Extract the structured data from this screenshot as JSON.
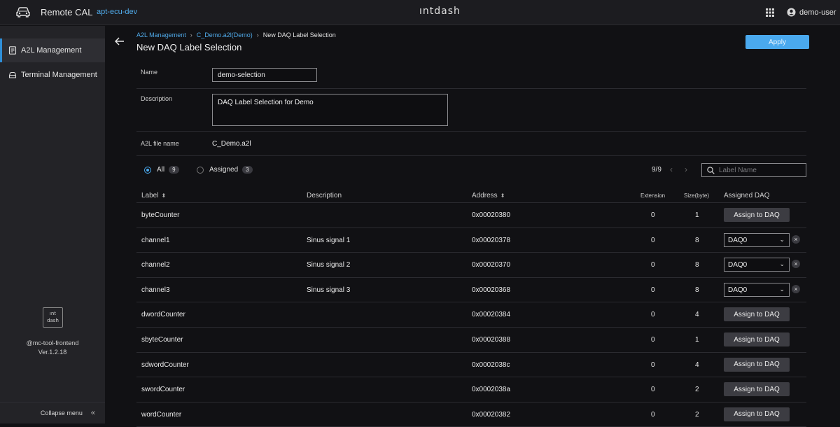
{
  "topbar": {
    "app_title": "Remote CAL",
    "environment": "apt-ecu-dev",
    "brand": "ıntdash",
    "user": "demo-user",
    "icons": [
      "car-icon",
      "apps-grid-icon",
      "user-icon"
    ]
  },
  "sidebar": {
    "items": [
      {
        "label": "A2L Management",
        "icon": "document-icon",
        "active": true
      },
      {
        "label": "Terminal Management",
        "icon": "terminal-icon",
        "active": false
      }
    ],
    "logo_line1": "ıntdash",
    "logo_text_top": "ınt",
    "logo_text_bottom": "dash",
    "package": "@mc-tool-frontend",
    "version": "Ver.1.2.18",
    "collapse_label": "Collapse menu"
  },
  "header": {
    "breadcrumb": [
      "A2L Management",
      "C_Demo.a2l(Demo)",
      "New DAQ Label Selection"
    ],
    "title": "New DAQ Label Selection",
    "apply_label": "Apply"
  },
  "form": {
    "name_label": "Name",
    "name_value": "demo-selection",
    "description_label": "Description",
    "description_value": "DAQ Label Selection for Demo",
    "a2l_label": "A2L file name",
    "a2l_value": "C_Demo.a2l"
  },
  "filter": {
    "all_label": "All",
    "all_count": "9",
    "assigned_label": "Assigned",
    "assigned_count": "3",
    "paging": "9/9",
    "search_placeholder": "Label Name"
  },
  "table": {
    "headers": {
      "label": "Label",
      "description": "Description",
      "address": "Address",
      "extension": "Extension",
      "size": "Size(byte)",
      "assigned": "Assigned DAQ"
    },
    "assign_button_label": "Assign to DAQ",
    "rows": [
      {
        "label": "byteCounter",
        "description": "",
        "address": "0x00020380",
        "extension": "0",
        "size": "1",
        "daq": ""
      },
      {
        "label": "channel1",
        "description": "Sinus signal 1",
        "address": "0x00020378",
        "extension": "0",
        "size": "8",
        "daq": "DAQ0"
      },
      {
        "label": "channel2",
        "description": "Sinus signal 2",
        "address": "0x00020370",
        "extension": "0",
        "size": "8",
        "daq": "DAQ0"
      },
      {
        "label": "channel3",
        "description": "Sinus signal 3",
        "address": "0x00020368",
        "extension": "0",
        "size": "8",
        "daq": "DAQ0"
      },
      {
        "label": "dwordCounter",
        "description": "",
        "address": "0x00020384",
        "extension": "0",
        "size": "4",
        "daq": ""
      },
      {
        "label": "sbyteCounter",
        "description": "",
        "address": "0x00020388",
        "extension": "0",
        "size": "1",
        "daq": ""
      },
      {
        "label": "sdwordCounter",
        "description": "",
        "address": "0x0002038c",
        "extension": "0",
        "size": "4",
        "daq": ""
      },
      {
        "label": "swordCounter",
        "description": "",
        "address": "0x0002038a",
        "extension": "0",
        "size": "2",
        "daq": ""
      },
      {
        "label": "wordCounter",
        "description": "",
        "address": "0x00020382",
        "extension": "0",
        "size": "2",
        "daq": ""
      }
    ]
  },
  "colors": {
    "accent": "#4aa9ee",
    "background": "#111114",
    "sidebar": "#232327"
  }
}
